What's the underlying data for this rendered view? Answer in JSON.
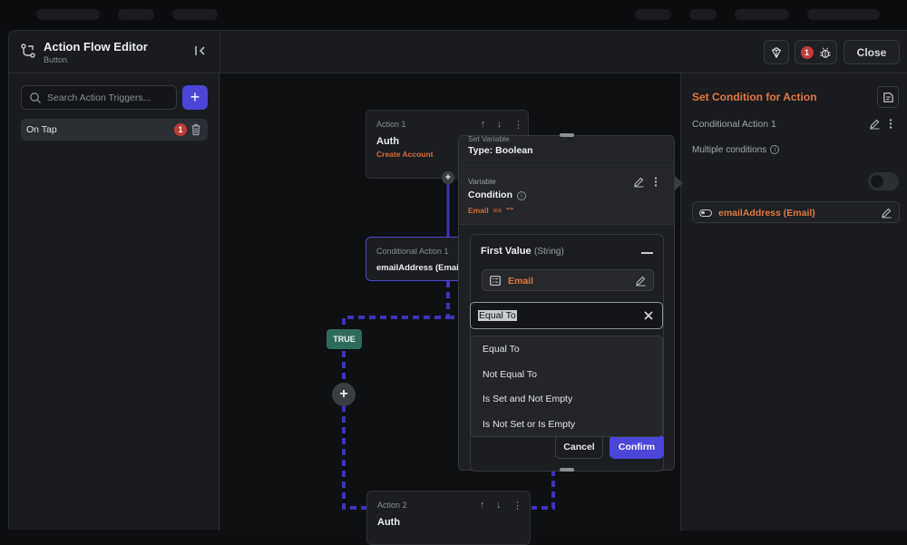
{
  "header": {
    "title": "Action Flow Editor",
    "subtitle": "Button",
    "error_count": "1",
    "close_label": "Close"
  },
  "sidebar": {
    "search_placeholder": "Search Action Triggers...",
    "add_label": "+",
    "triggers": [
      {
        "label": "On Tap",
        "error_count": "1"
      }
    ]
  },
  "canvas": {
    "nodes": [
      {
        "label": "Action 1",
        "title": "Auth",
        "subtitle": "Create Account"
      },
      {
        "label": "Conditional Action 1",
        "title": "emailAddress (Email)"
      },
      {
        "label": "Action 2",
        "title": "Auth"
      }
    ],
    "true_label": "TRUE"
  },
  "popover": {
    "top_label": "Set Variable",
    "top_type": "Type: Boolean",
    "variable_label": "Variable",
    "variable_title": "Condition",
    "variable_expr": "Email  ==  \"\"",
    "first_value_title": "First Value",
    "first_value_type": "(String)",
    "first_value_field": "Email",
    "operator_selected": "Equal To",
    "operator_options": [
      "Equal To",
      "Not Equal To",
      "Is Set and Not Empty",
      "Is Not Set or Is Empty"
    ],
    "cancel_label": "Cancel",
    "confirm_label": "Confirm"
  },
  "right_panel": {
    "title": "Set Condition for Action",
    "conditional_label": "Conditional Action 1",
    "multiple_label": "Multiple conditions",
    "condition_chip": "emailAddress (Email)"
  },
  "colors": {
    "accent": "#4b45d9",
    "orange": "#e0793f",
    "error": "#c23a3a",
    "true_tag": "#2f6b5a",
    "connector": "#3b35b8"
  }
}
